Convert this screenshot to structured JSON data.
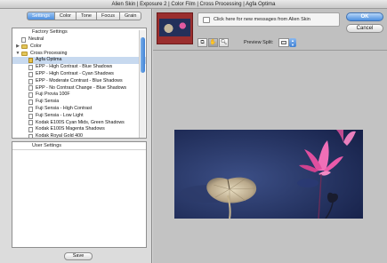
{
  "window": {
    "title": "Alien Skin | Exposure 2 | Color Film | Cross Processing | Agfa Optima"
  },
  "tabs": [
    {
      "label": "Settings",
      "active": true
    },
    {
      "label": "Color",
      "active": false
    },
    {
      "label": "Tone",
      "active": false
    },
    {
      "label": "Focus",
      "active": false
    },
    {
      "label": "Grain",
      "active": false
    }
  ],
  "factory": {
    "header": "Factory Settings",
    "items": [
      {
        "label": "Neutral",
        "level": 0,
        "type": "doc"
      },
      {
        "label": "Color",
        "level": 0,
        "type": "folder",
        "expanded": false
      },
      {
        "label": "Cross Processing",
        "level": 0,
        "type": "folder",
        "expanded": true
      },
      {
        "label": "Agfa Optima",
        "level": 1,
        "type": "doc",
        "selected": true
      },
      {
        "label": "EPP - High Contrast - Blue Shadows",
        "level": 1,
        "type": "doc"
      },
      {
        "label": "EPP - High Contrast - Cyan Shadows",
        "level": 1,
        "type": "doc"
      },
      {
        "label": "EPP - Moderate Contrast - Blue Shadows",
        "level": 1,
        "type": "doc"
      },
      {
        "label": "EPP - No Contrast Change - Blue Shadows",
        "level": 1,
        "type": "doc"
      },
      {
        "label": "Fuji Provia 100F",
        "level": 1,
        "type": "doc"
      },
      {
        "label": "Fuji Sensia",
        "level": 1,
        "type": "doc"
      },
      {
        "label": "Fuji Sensia - High Contrast",
        "level": 1,
        "type": "doc"
      },
      {
        "label": "Fuji Sensia - Low Light",
        "level": 1,
        "type": "doc"
      },
      {
        "label": "Kodak E100S Cyan Mids, Green Shadows",
        "level": 1,
        "type": "doc"
      },
      {
        "label": "Kodak E100S Magenta Shadows",
        "level": 1,
        "type": "doc"
      },
      {
        "label": "Kodak Royal Gold 400",
        "level": 1,
        "type": "doc"
      }
    ]
  },
  "user_settings": {
    "header": "User Settings"
  },
  "buttons": {
    "save": "Save",
    "ok": "OK",
    "cancel": "Cancel"
  },
  "messages": {
    "text": "Click here for new messages from Alien Skin"
  },
  "preview": {
    "split_label": "Preview Split:"
  },
  "icons": {
    "tools": [
      "crop-tool-icon",
      "hand-tool-icon",
      "zoom-tool-icon"
    ]
  },
  "colors": {
    "accent": "#4b8fe0",
    "selection": "#c7d9ef",
    "folder": "#e3c65a"
  }
}
